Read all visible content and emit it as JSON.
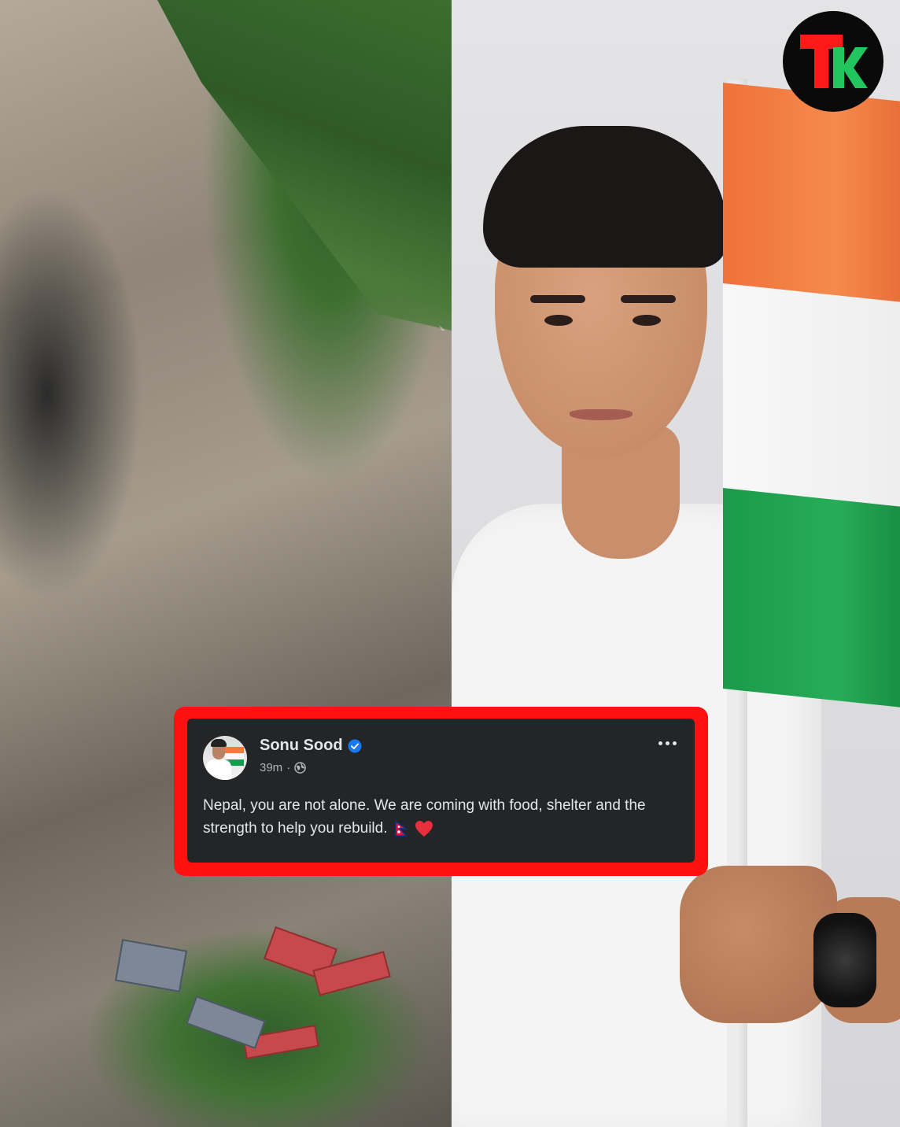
{
  "logo": {
    "text": "TK",
    "colors": {
      "t": "#ff1a1a",
      "k": "#22c55e"
    }
  },
  "post": {
    "author_name": "Sonu Sood",
    "verified": true,
    "timestamp": "39m",
    "separator": "·",
    "audience_icon": "globe-icon",
    "text": "Nepal, you are not alone. We are coming with food, shelter and the strength to help you rebuild.",
    "emojis": [
      "nepal-flag-icon",
      "red-heart-icon"
    ],
    "more_icon": "more-options-icon"
  },
  "colors": {
    "frame_border": "#ff1111",
    "card_bg": "#242527",
    "text_primary": "#e4e6eb",
    "text_secondary": "#b0b3b8",
    "verified_blue": "#1877f2",
    "flag_saffron": "#f0713c",
    "flag_green": "#1a9a4a"
  }
}
